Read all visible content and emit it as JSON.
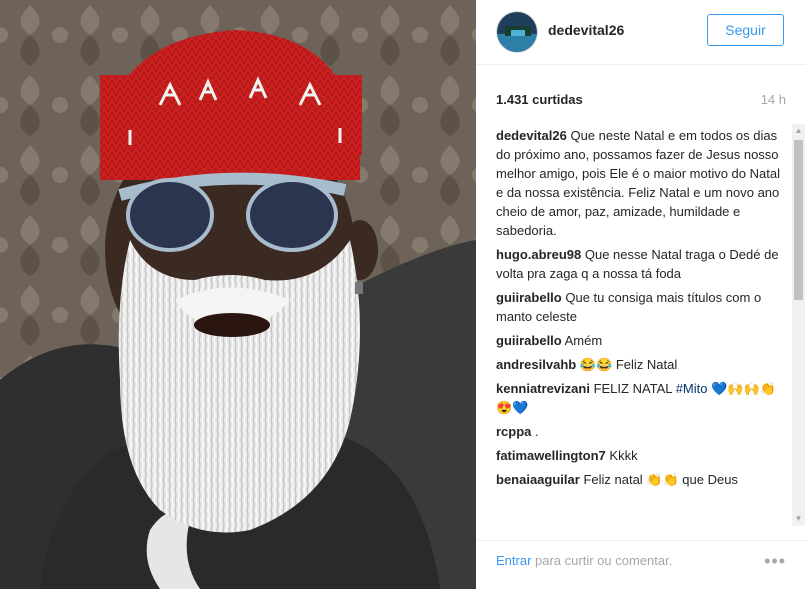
{
  "header": {
    "username": "dedevital26",
    "follow_label": "Seguir"
  },
  "stats": {
    "likes": "1.431 curtidas",
    "time": "14 h"
  },
  "comments": [
    {
      "user": "dedevital26",
      "text": "Que neste Natal e em todos os dias do próximo ano, possamos fazer de Jesus nosso melhor amigo, pois Ele é o maior motivo do Natal e da nossa existência. Feliz Natal e um novo ano cheio de amor, paz, amizade, humildade e sabedoria."
    },
    {
      "user": "hugo.abreu98",
      "text": "Que nesse Natal traga o Dedé de volta pra zaga q a nossa tá foda"
    },
    {
      "user": "guiirabello",
      "text": "Que tu consiga mais títulos com o manto celeste"
    },
    {
      "user": "guiirabello",
      "text": "Amém"
    },
    {
      "user": "andresilvahb",
      "text": "😂😂 Feliz Natal"
    },
    {
      "user": "kenniatrevizani",
      "text": "FELIZ NATAL",
      "hashtag": "#Mito",
      "extra": "💙🙌🙌👏😍💙"
    },
    {
      "user": "rcppa",
      "text": "."
    },
    {
      "user": "fatimawellington7",
      "text": "Kkkk"
    },
    {
      "user": "benaiaaguilar",
      "text": "Feliz natal 👏👏 que Deus"
    }
  ],
  "footer": {
    "login_link": "Entrar",
    "prompt": " para curtir ou comentar.",
    "more": "•••"
  },
  "colors": {
    "accent": "#3897f0",
    "hashtag": "#003569",
    "muted": "#a5a7aa",
    "hat": "#d32222"
  },
  "icons": {
    "more": "more-options-icon",
    "scroll_up": "scroll-up-icon",
    "scroll_down": "scroll-down-icon"
  }
}
